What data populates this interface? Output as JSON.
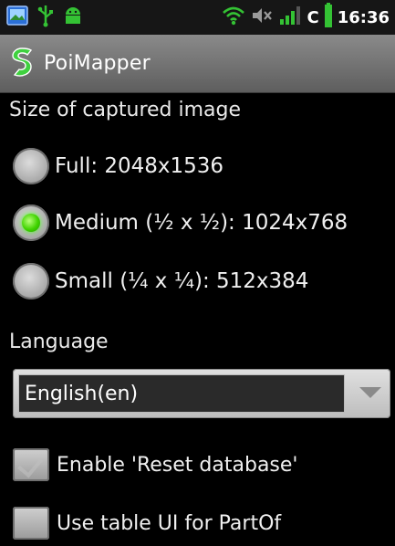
{
  "status_bar": {
    "icons_left": [
      "photo-notification-icon",
      "usb-icon",
      "android-debug-icon"
    ],
    "icons_right": [
      "wifi-icon",
      "muted-volume-icon",
      "signal-icon"
    ],
    "carrier_letter": "C",
    "battery_icon": "battery-icon",
    "time": "16:36"
  },
  "title_bar": {
    "app_icon": "poimapper-logo-icon",
    "title": "PoiMapper"
  },
  "image_size": {
    "header": "Size of captured image",
    "options": [
      {
        "label": "Full: 2048x1536",
        "checked": false
      },
      {
        "label": "Medium (½ x ½): 1024x768",
        "checked": true
      },
      {
        "label": "Small (¼ x ¼): 512x384",
        "checked": false
      }
    ]
  },
  "language": {
    "header": "Language",
    "selected": "English(en)"
  },
  "checkboxes": [
    {
      "label": "Enable 'Reset database'",
      "checked": false
    },
    {
      "label": "Use table UI for PartOf",
      "checked": false
    }
  ],
  "colors": {
    "accent_green": "#40d400",
    "title_bar": "#6e6e6e",
    "background": "#000000"
  }
}
